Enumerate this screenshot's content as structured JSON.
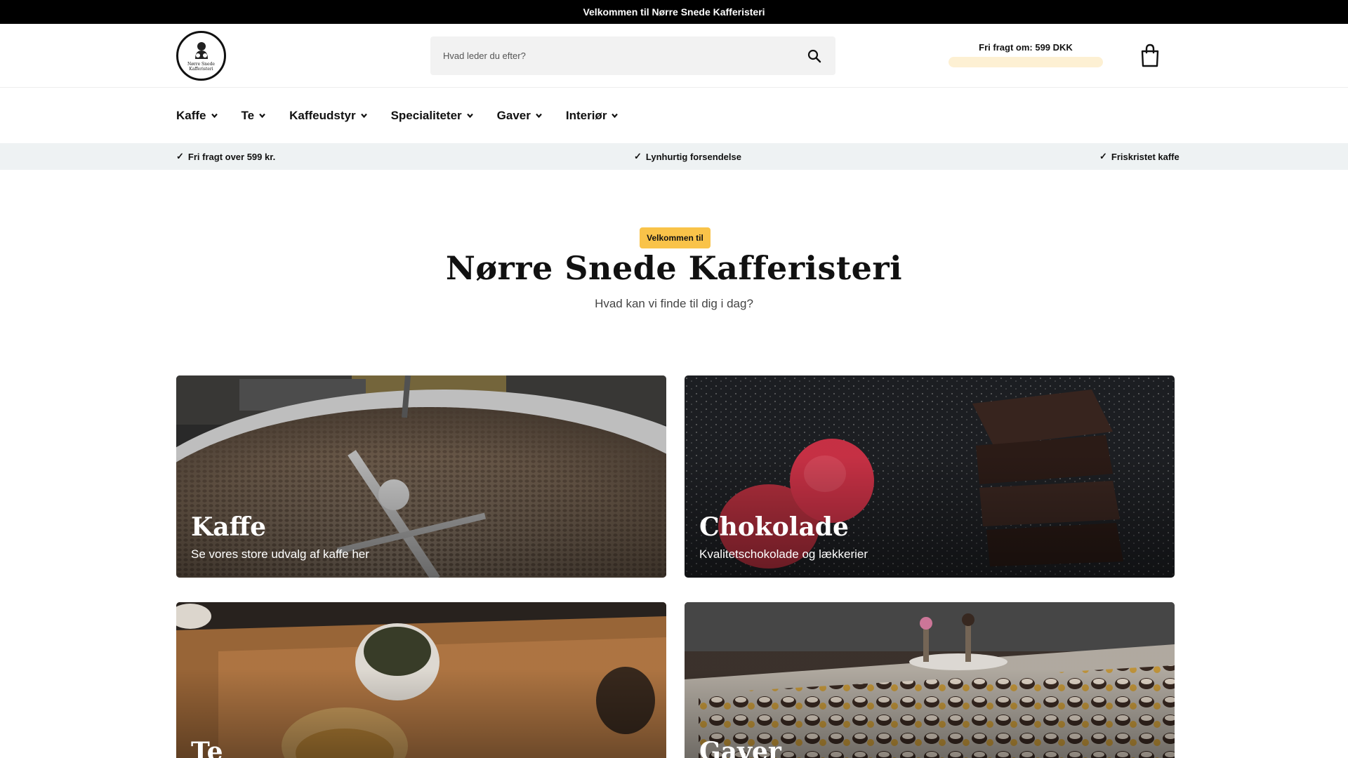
{
  "announcement": "Velkommen til Nørre Snede Kafferisteri",
  "logo": {
    "text_line1": "Nørre Snede",
    "text_line2": "Kafferisteri",
    "icon": "roaster-figure-icon"
  },
  "search": {
    "placeholder": "Hvad leder du efter?",
    "icon": "search-icon"
  },
  "free_shipping": {
    "label": "Fri fragt om: 599 DKK",
    "progress": 0
  },
  "cart": {
    "icon": "shopping-bag-icon"
  },
  "nav": [
    {
      "label": "Kaffe"
    },
    {
      "label": "Te"
    },
    {
      "label": "Kaffeudstyr"
    },
    {
      "label": "Specialiteter"
    },
    {
      "label": "Gaver"
    },
    {
      "label": "Interiør"
    }
  ],
  "usp": [
    {
      "label": "Fri fragt over 599 kr.",
      "check": "✓"
    },
    {
      "label": "Lynhurtig forsendelse",
      "check": "✓"
    },
    {
      "label": "Friskristet kaffe",
      "check": "✓"
    }
  ],
  "hero": {
    "badge": "Velkommen til",
    "title": "Nørre Snede Kafferisteri",
    "subtitle": "Hvad kan vi finde til dig i dag?"
  },
  "categories": [
    {
      "title": "Kaffe",
      "subtitle": "Se vores store udvalg af kaffe her"
    },
    {
      "title": "Chokolade",
      "subtitle": "Kvalitetschokolade og lækkerier"
    },
    {
      "title": "Te",
      "subtitle": ""
    },
    {
      "title": "Gaver",
      "subtitle": ""
    }
  ],
  "colors": {
    "badge": "#f9c349",
    "usp_bg": "#eef2f3",
    "topbar": "#000000",
    "shipping_bar": "#fdf0d3"
  }
}
